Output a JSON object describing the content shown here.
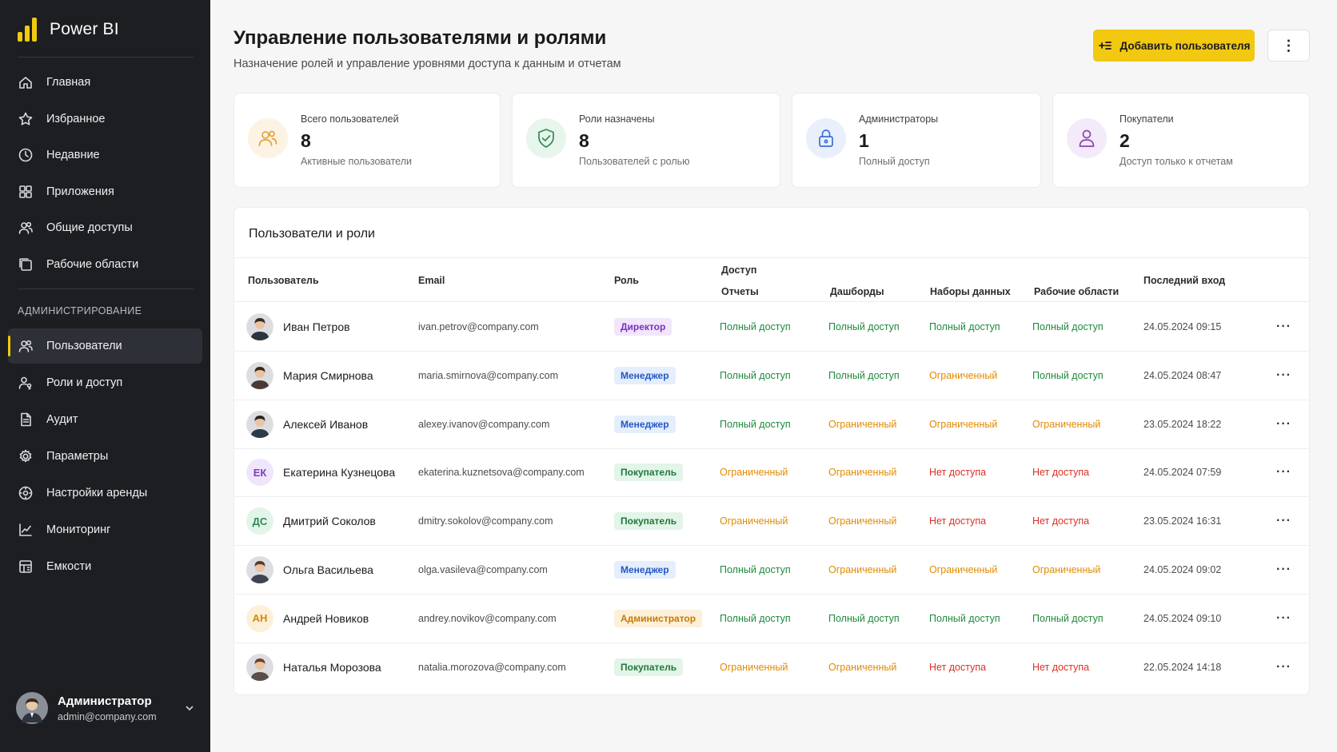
{
  "app": {
    "name": "Power BI"
  },
  "nav": {
    "items": [
      {
        "label": "Главная",
        "icon": "home-icon"
      },
      {
        "label": "Избранное",
        "icon": "star-icon"
      },
      {
        "label": "Недавние",
        "icon": "clock-icon"
      },
      {
        "label": "Приложения",
        "icon": "apps-icon"
      },
      {
        "label": "Общие доступы",
        "icon": "shared-users-icon"
      },
      {
        "label": "Рабочие области",
        "icon": "workspaces-icon"
      }
    ],
    "admin_section_label": "АДМИНИСТРИРОВАНИЕ",
    "admin_items": [
      {
        "label": "Пользователи",
        "icon": "users-icon",
        "active": true
      },
      {
        "label": "Роли и доступ",
        "icon": "user-key-icon"
      },
      {
        "label": "Аудит",
        "icon": "document-icon"
      },
      {
        "label": "Параметры",
        "icon": "gear-icon"
      },
      {
        "label": "Настройки аренды",
        "icon": "tenant-settings-icon"
      },
      {
        "label": "Мониторинг",
        "icon": "chart-line-icon"
      },
      {
        "label": "Емкости",
        "icon": "capacity-icon"
      }
    ]
  },
  "current_user": {
    "name": "Администратор",
    "email": "admin@company.com"
  },
  "header": {
    "title": "Управление пользователями и ролями",
    "subtitle": "Назначение ролей и управление уровнями доступа к данным и отчетам",
    "add_button_label": "Добавить пользователя"
  },
  "stats": [
    {
      "label": "Всего пользователей",
      "value": "8",
      "sub": "Активные пользователи",
      "icon": "users-icon",
      "color": "#e6a23c",
      "bg": "#fdf3e3"
    },
    {
      "label": "Роли назначены",
      "value": "8",
      "sub": "Пользователей с ролью",
      "icon": "shield-check-icon",
      "color": "#2e8b57",
      "bg": "#e8f5ec"
    },
    {
      "label": "Администраторы",
      "value": "1",
      "sub": "Полный доступ",
      "icon": "lock-icon",
      "color": "#3b6fd8",
      "bg": "#e9f0fc"
    },
    {
      "label": "Покупатели",
      "value": "2",
      "sub": "Доступ только к отчетам",
      "icon": "user-icon",
      "color": "#8e44ad",
      "bg": "#f3eafa"
    }
  ],
  "table": {
    "title": "Пользователи и роли",
    "headers": {
      "user": "Пользователь",
      "email": "Email",
      "role": "Роль",
      "access_group": "Доступ",
      "reports": "Отчеты",
      "dashboards": "Дашборды",
      "datasets": "Наборы данных",
      "workspaces": "Рабочие области",
      "last_login": "Последний вход"
    },
    "rows": [
      {
        "name": "Иван Петров",
        "email": "ivan.petrov@company.com",
        "role": "Директор",
        "role_kind": "director",
        "avatar": "photo",
        "initials": "",
        "reports": "Полный доступ",
        "dashboards": "Полный доступ",
        "datasets": "Полный доступ",
        "workspaces": "Полный доступ",
        "last_login": "24.05.2024 09:15"
      },
      {
        "name": "Мария Смирнова",
        "email": "maria.smirnova@company.com",
        "role": "Менеджер",
        "role_kind": "manager",
        "avatar": "photo",
        "initials": "",
        "reports": "Полный доступ",
        "dashboards": "Полный доступ",
        "datasets": "Ограниченный",
        "workspaces": "Полный доступ",
        "last_login": "24.05.2024 08:47"
      },
      {
        "name": "Алексей Иванов",
        "email": "alexey.ivanov@company.com",
        "role": "Менеджер",
        "role_kind": "manager",
        "avatar": "photo",
        "initials": "",
        "reports": "Полный доступ",
        "dashboards": "Ограниченный",
        "datasets": "Ограниченный",
        "workspaces": "Ограниченный",
        "last_login": "23.05.2024 18:22"
      },
      {
        "name": "Екатерина Кузнецова",
        "email": "ekaterina.kuznetsova@company.com",
        "role": "Покупатель",
        "role_kind": "buyer",
        "avatar": "initials",
        "initials": "ЕК",
        "reports": "Ограниченный",
        "dashboards": "Ограниченный",
        "datasets": "Нет доступа",
        "workspaces": "Нет доступа",
        "last_login": "24.05.2024 07:59"
      },
      {
        "name": "Дмитрий Соколов",
        "email": "dmitry.sokolov@company.com",
        "role": "Покупатель",
        "role_kind": "buyer",
        "avatar": "initials",
        "initials": "ДС",
        "reports": "Ограниченный",
        "dashboards": "Ограниченный",
        "datasets": "Нет доступа",
        "workspaces": "Нет доступа",
        "last_login": "23.05.2024 16:31"
      },
      {
        "name": "Ольга Васильева",
        "email": "olga.vasileva@company.com",
        "role": "Менеджер",
        "role_kind": "manager",
        "avatar": "photo",
        "initials": "",
        "reports": "Полный доступ",
        "dashboards": "Ограниченный",
        "datasets": "Ограниченный",
        "workspaces": "Ограниченный",
        "last_login": "24.05.2024 09:02"
      },
      {
        "name": "Андрей Новиков",
        "email": "andrey.novikov@company.com",
        "role": "Администратор",
        "role_kind": "admin",
        "avatar": "initials",
        "initials": "АН",
        "reports": "Полный доступ",
        "dashboards": "Полный доступ",
        "datasets": "Полный доступ",
        "workspaces": "Полный доступ",
        "last_login": "24.05.2024 09:10"
      },
      {
        "name": "Наталья Морозова",
        "email": "natalia.morozova@company.com",
        "role": "Покупатель",
        "role_kind": "buyer",
        "avatar": "photo",
        "initials": "",
        "reports": "Ограниченный",
        "dashboards": "Ограниченный",
        "datasets": "Нет доступа",
        "workspaces": "Нет доступа",
        "last_login": "22.05.2024 14:18"
      }
    ]
  },
  "colors": {
    "accent": "#f2c811",
    "sidebar_bg": "#1c1e22",
    "full_access": "#1e8a3c",
    "limited": "#e28a00",
    "no_access": "#d93025"
  }
}
